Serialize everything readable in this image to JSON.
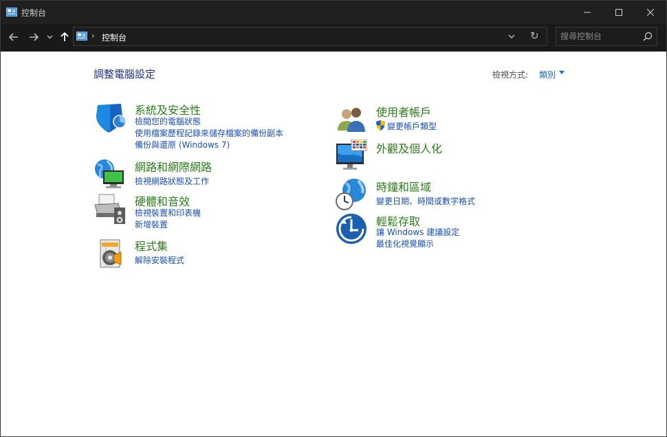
{
  "window": {
    "title": "控制台",
    "controls": {
      "minimize": "—",
      "maximize": "☐",
      "close": "✕"
    }
  },
  "navigation": {
    "back_icon": "arrow-left-icon",
    "forward_icon": "arrow-right-icon",
    "recent_icon": "chevron-down-icon",
    "up_icon": "arrow-up-icon",
    "breadcrumb_separator": "›",
    "address_text": "控制台",
    "dropdown_glyph": "⌄",
    "refresh_glyph": "↻"
  },
  "search": {
    "placeholder": "搜尋控制台",
    "icon": "search-icon"
  },
  "page": {
    "title": "調整電腦設定",
    "view_by_label": "檢視方式:",
    "view_by_value": "類別"
  },
  "categories": [
    {
      "title": "系統及安全性",
      "icon": "shield-icon",
      "links": [
        "檢閱您的電腦狀態",
        "使用檔案歷程記錄來儲存檔案的備份副本",
        "備份與還原 (Windows 7)"
      ]
    },
    {
      "title": "網路和網際網路",
      "icon": "network-globe-icon",
      "links": [
        "檢視網路狀態及工作"
      ]
    },
    {
      "title": "硬體和音效",
      "icon": "printer-speaker-icon",
      "links": [
        "檢視裝置和印表機",
        "新增裝置"
      ]
    },
    {
      "title": "程式集",
      "icon": "programs-disc-icon",
      "links": [
        "解除安裝程式"
      ]
    },
    {
      "title": "使用者帳戶",
      "icon": "users-icon",
      "links": [
        "變更帳戶類型"
      ]
    },
    {
      "title": "外觀及個人化",
      "icon": "monitor-palette-icon",
      "links": []
    },
    {
      "title": "時鐘和區域",
      "icon": "clock-globe-icon",
      "links": [
        "變更日期、時間或數字格式"
      ]
    },
    {
      "title": "輕鬆存取",
      "icon": "ease-of-access-icon",
      "links": [
        "讓 Windows 建議設定",
        "最佳化視覺顯示"
      ]
    }
  ],
  "colors": {
    "category_title": "#2d7d1a",
    "link": "#1a4fb8",
    "page_title": "#1e3287",
    "titlebar_bg": "#202020",
    "navbar_bg": "#191919"
  }
}
